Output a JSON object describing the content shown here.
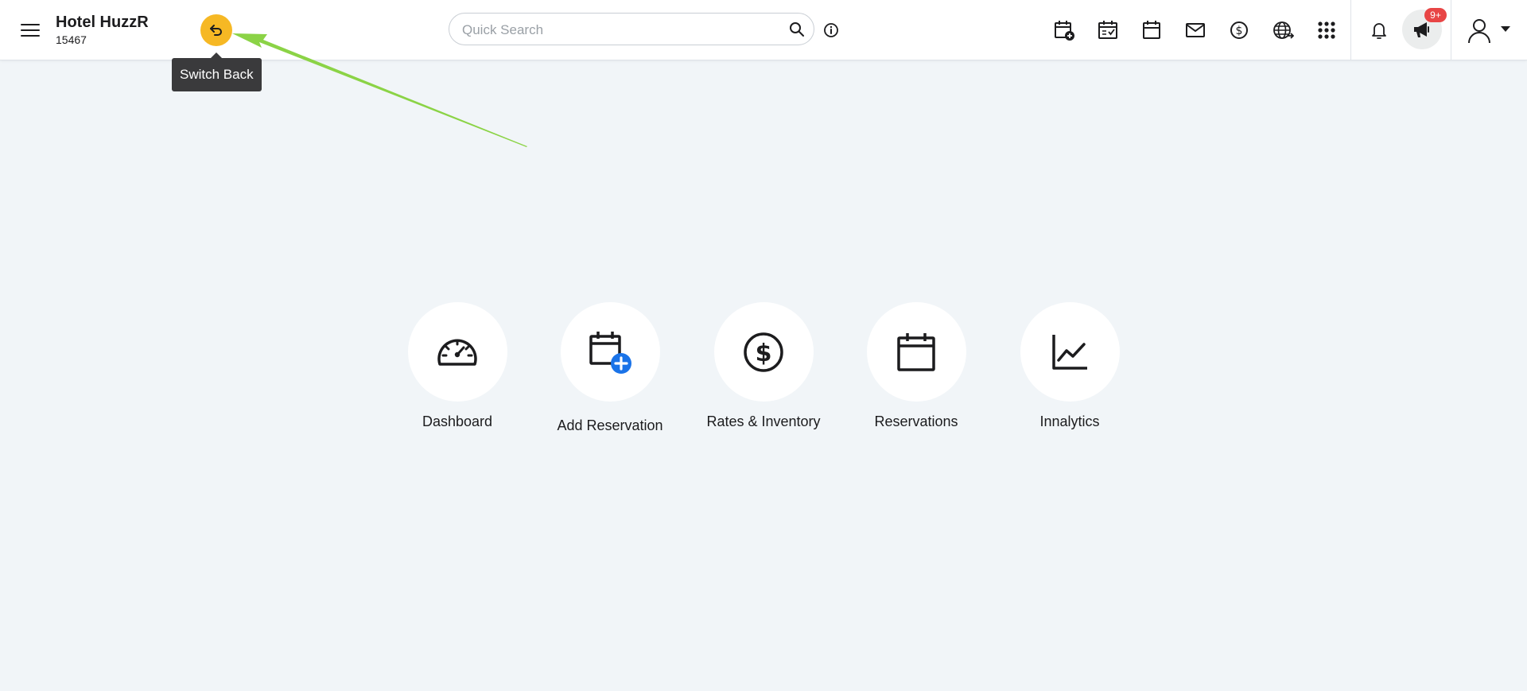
{
  "header": {
    "hotel_name": "Hotel HuzzR",
    "hotel_id": "15467",
    "switch_back_tooltip": "Switch Back",
    "search_placeholder": "Quick Search",
    "notification_badge": "9+",
    "toolbar_icons": [
      "calendar-add-icon",
      "calendar-check-icon",
      "calendar-icon",
      "mail-icon",
      "dollar-icon",
      "globe-icon",
      "apps-grid-icon"
    ]
  },
  "shortcuts": [
    {
      "label": "Dashboard",
      "icon": "gauge-icon"
    },
    {
      "label": "Add Reservation",
      "icon": "calendar-plus-icon"
    },
    {
      "label": "Rates & Inventory",
      "icon": "dollar-circle-icon"
    },
    {
      "label": "Reservations",
      "icon": "calendar-icon"
    },
    {
      "label": "Innalytics",
      "icon": "line-chart-icon"
    }
  ],
  "colors": {
    "accent": "#f6b824",
    "badge": "#e84545",
    "annotation_arrow": "#8bd346",
    "add_badge": "#1a73e8"
  }
}
